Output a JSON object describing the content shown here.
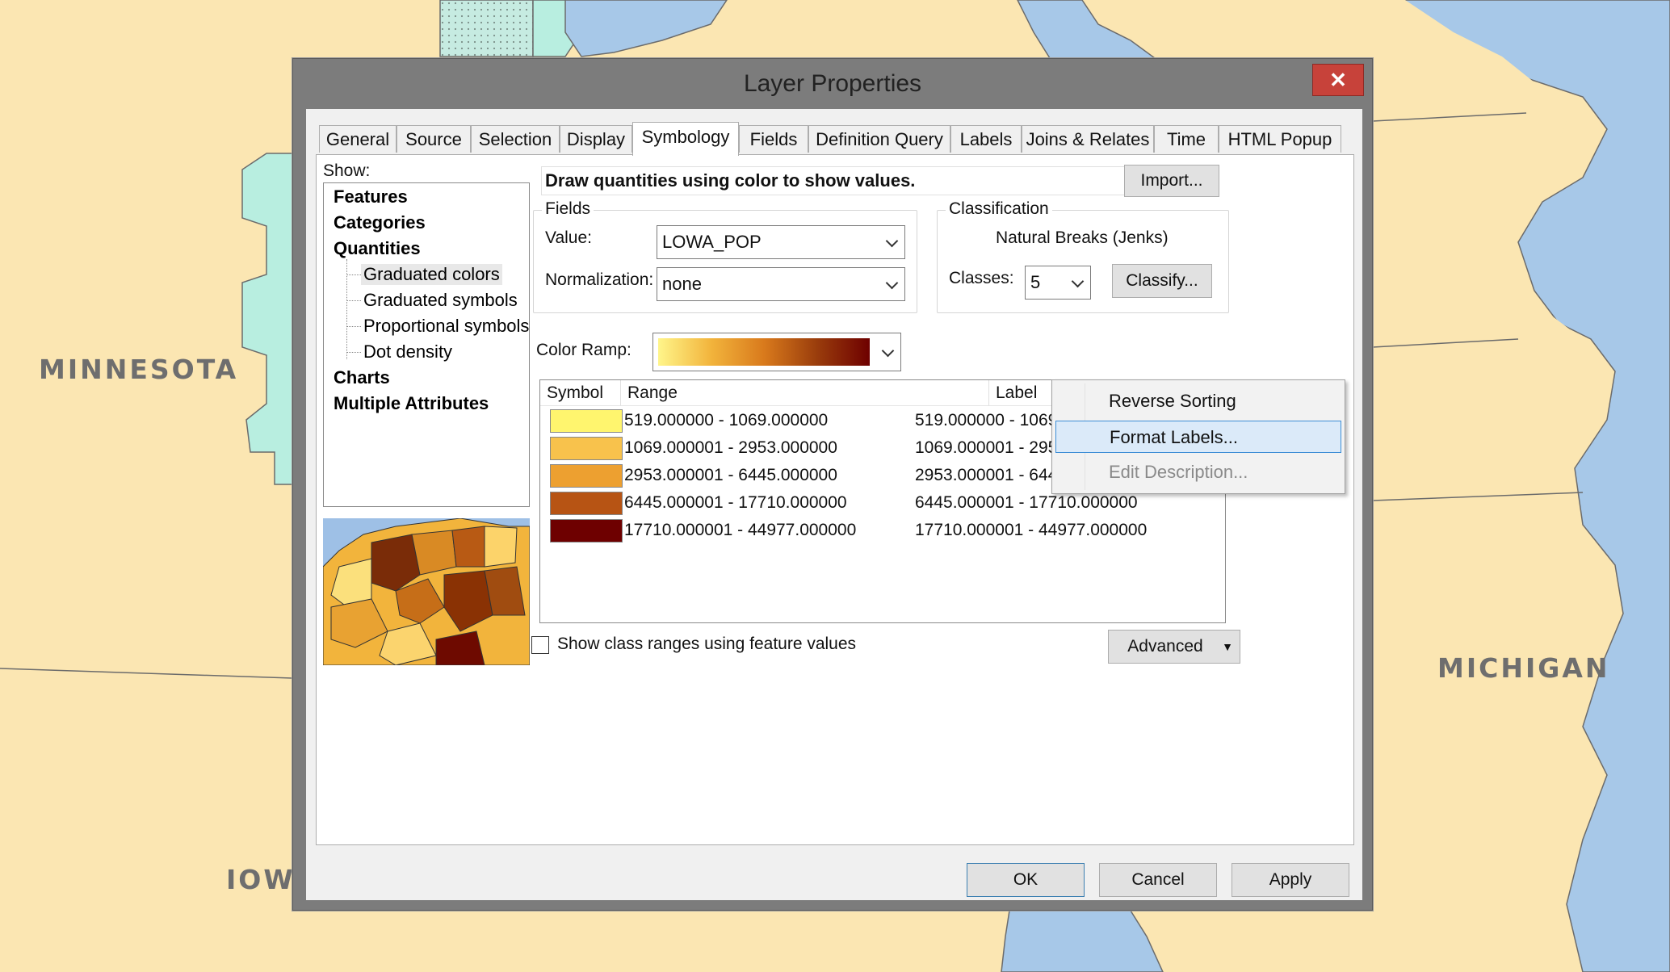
{
  "map_labels": {
    "minnesota": "MINNESOTA",
    "iowa": "IOWA",
    "michigan": "MICHIGAN"
  },
  "dialog": {
    "title": "Layer Properties",
    "close_glyph": "✕",
    "tabs": [
      "General",
      "Source",
      "Selection",
      "Display",
      "Symbology",
      "Fields",
      "Definition Query",
      "Labels",
      "Joins & Relates",
      "Time",
      "HTML Popup"
    ],
    "active_tab": "Symbology",
    "show_label": "Show:",
    "tree": {
      "features": "Features",
      "categories": "Categories",
      "quantities": "Quantities",
      "graduated_colors": "Graduated colors",
      "graduated_symbols": "Graduated symbols",
      "proportional_symbols": "Proportional symbols",
      "dot_density": "Dot density",
      "charts": "Charts",
      "multiple_attributes": "Multiple Attributes"
    },
    "description": "Draw quantities using color to show values.",
    "import_button": "Import...",
    "fields": {
      "title": "Fields",
      "value_label": "Value:",
      "value": "LOWA_POP",
      "normalization_label": "Normalization:",
      "normalization": "none"
    },
    "classification": {
      "title": "Classification",
      "method": "Natural Breaks (Jenks)",
      "classes_label": "Classes:",
      "classes": "5",
      "classify_button": "Classify..."
    },
    "color_ramp_label": "Color Ramp:",
    "ramp_colors": [
      "#fff58a",
      "#f2b43c",
      "#d97a1c",
      "#9a3d0c",
      "#6e0000"
    ],
    "grid": {
      "headers": {
        "symbol": "Symbol",
        "range": "Range",
        "label": "Label"
      },
      "rows": [
        {
          "color": "#fff56e",
          "range": "519.000000 - 1069.000000",
          "label": "519.000000 - 1069"
        },
        {
          "color": "#f8c24c",
          "range": "1069.000001 - 2953.000000",
          "label": "1069.000001 - 295"
        },
        {
          "color": "#eda030",
          "range": "2953.000001 - 6445.000000",
          "label": "2953.000001 - 644"
        },
        {
          "color": "#b75414",
          "range": "6445.000001 - 17710.000000",
          "label": "6445.000001 - 17710.000000"
        },
        {
          "color": "#6e0000",
          "range": "17710.000001 - 44977.000000",
          "label": "17710.000001 - 44977.000000"
        }
      ]
    },
    "show_class_ranges": "Show class ranges using feature values",
    "advanced_button": "Advanced",
    "ok_button": "OK",
    "cancel_button": "Cancel",
    "apply_button": "Apply"
  },
  "context_menu": {
    "items": [
      "Reverse Sorting",
      "Format Labels...",
      "Edit Description..."
    ],
    "highlighted": "Format Labels...",
    "disabled": "Edit Description..."
  }
}
